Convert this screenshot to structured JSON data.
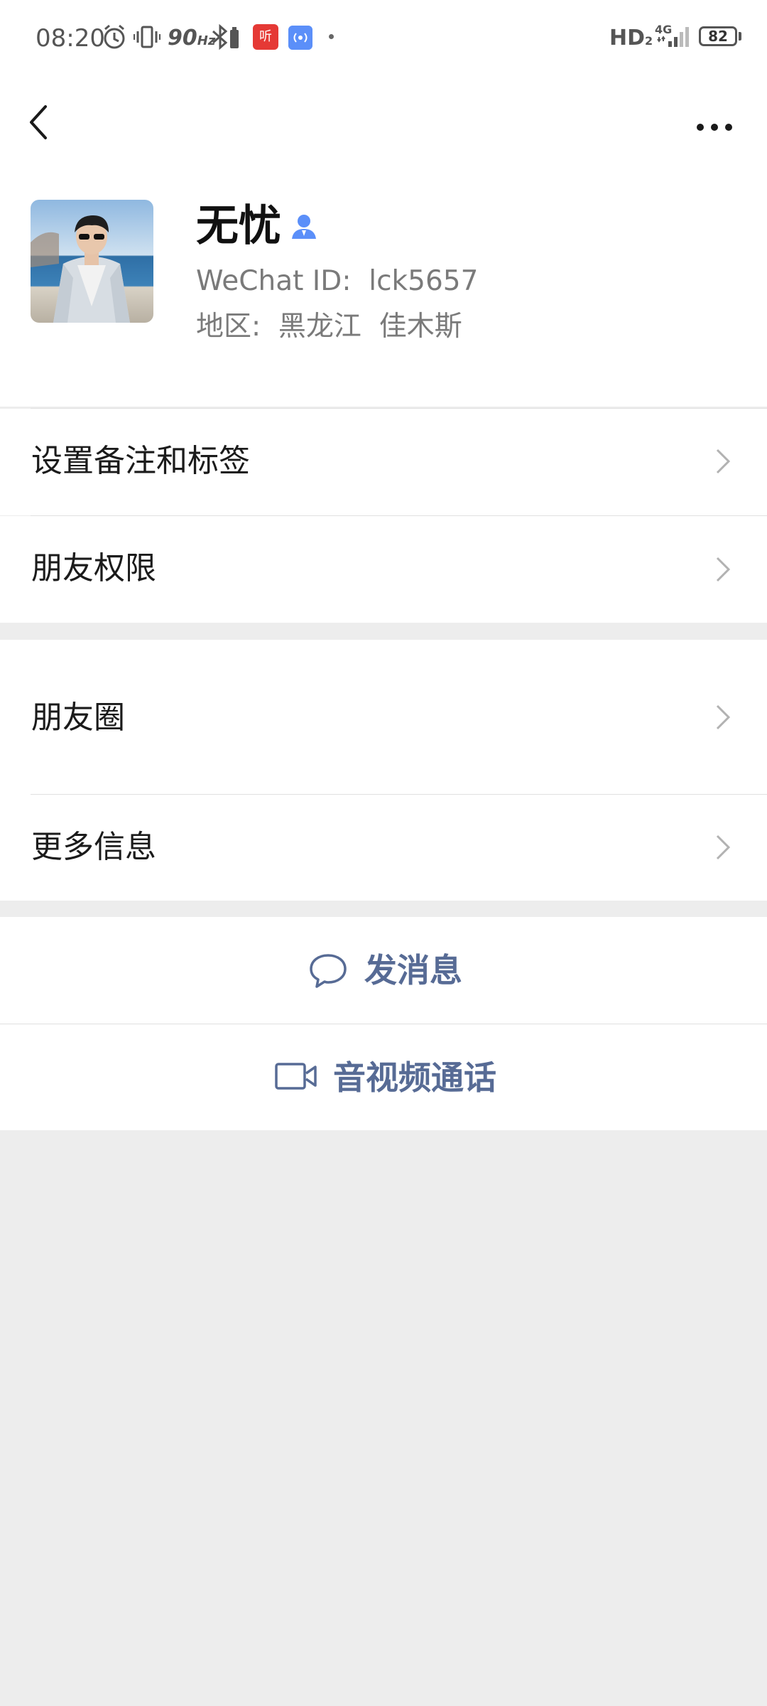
{
  "status_bar": {
    "time": "08:20",
    "refresh_rate": "90",
    "refresh_unit": "Hz",
    "hd_label": "HD",
    "hd_sub": "2",
    "network": "4G",
    "battery": "82",
    "icons": [
      "alarm-icon",
      "vibrate-icon",
      "bluetooth-icon",
      "ximalaya-app-icon",
      "hotspot-app-icon",
      "signal-icon",
      "battery-icon"
    ]
  },
  "nav": {
    "icons": [
      "back-chevron-icon",
      "more-dots-icon"
    ]
  },
  "profile": {
    "name": "无忧",
    "wechat_id": "WeChat ID:  lck5657",
    "region": "地区:  黑龙江  佳木斯",
    "verified_icon": "contact-person-icon"
  },
  "menu": {
    "items": [
      {
        "label": "设置备注和标签"
      },
      {
        "label": "朋友权限"
      },
      {
        "label": "朋友圈"
      },
      {
        "label": "更多信息"
      }
    ]
  },
  "actions": {
    "send_message": "发消息",
    "video_call": "音视频通话"
  },
  "colors": {
    "background": "#ededed",
    "card": "#ffffff",
    "link": "#576b95",
    "verified": "#5b8ff9"
  }
}
